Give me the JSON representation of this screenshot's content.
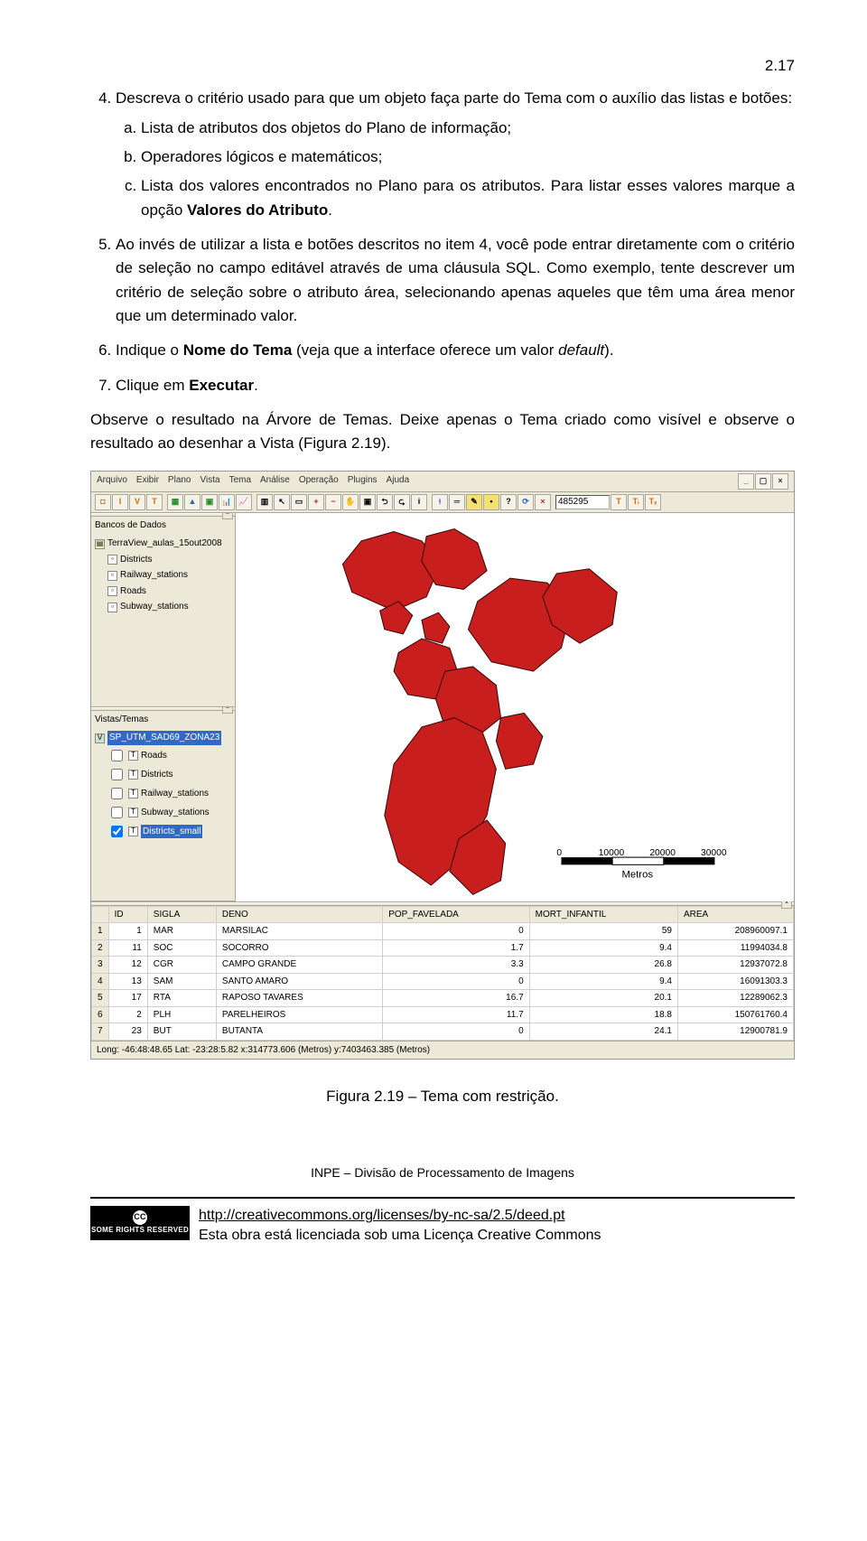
{
  "page_number": "2.17",
  "item4": {
    "lead": "Descreva o critério usado para que um objeto faça parte do Tema com o auxílio das listas e botões:",
    "a": "Lista de atributos dos objetos do Plano de informação;",
    "b": "Operadores lógicos e matemáticos;",
    "c_pre": "Lista dos valores encontrados no Plano para os atributos. Para listar esses valores marque a opção ",
    "c_bold": "Valores do Atributo",
    "c_post": "."
  },
  "item5": "Ao invés de utilizar a lista e botões descritos no item 4, você pode entrar diretamente com o critério de seleção no campo editável através de uma cláusula SQL. Como exemplo, tente descrever um critério de seleção sobre o atributo área, selecionando apenas aqueles que têm uma área menor que um determinado valor.",
  "item6": {
    "pre": "Indique o ",
    "bold": "Nome do Tema",
    "mid": " (veja que a interface oferece um valor ",
    "italic": "default",
    "post": ")."
  },
  "item7": {
    "pre": "Clique em ",
    "bold": "Executar",
    "post": "."
  },
  "observe": "Observe o resultado na Árvore de Temas. Deixe apenas o Tema criado como visível e observe o resultado ao desenhar a Vista (Figura 2.19).",
  "app": {
    "menu": [
      "Arquivo",
      "Exibir",
      "Plano",
      "Vista",
      "Tema",
      "Análise",
      "Operação",
      "Plugins",
      "Ajuda"
    ],
    "toolbar_input": "485295",
    "db_panel": {
      "title": "Bancos de Dados",
      "root": "TerraView_aulas_15out2008",
      "layers": [
        "Districts",
        "Railway_stations",
        "Roads",
        "Subway_stations"
      ]
    },
    "views_panel": {
      "title": "Vistas/Temas",
      "view": "SP_UTM_SAD69_ZONA23",
      "themes": [
        "Roads",
        "Districts",
        "Railway_stations",
        "Subway_stations",
        "Districts_small"
      ],
      "selected_index": 4
    },
    "scalebar": {
      "ticks": [
        "0",
        "10000",
        "20000",
        "30000"
      ],
      "label": "Metros"
    },
    "grid": {
      "headers": [
        "",
        "ID",
        "SIGLA",
        "DENO",
        "POP_FAVELADA",
        "MORT_INFANTIL",
        "AREA"
      ],
      "rows": [
        [
          "1",
          "1",
          "MAR",
          "MARSILAC",
          "0",
          "59",
          "208960097.1"
        ],
        [
          "2",
          "11",
          "SOC",
          "SOCORRO",
          "1.7",
          "9.4",
          "11994034.8"
        ],
        [
          "3",
          "12",
          "CGR",
          "CAMPO GRANDE",
          "3.3",
          "26.8",
          "12937072.8"
        ],
        [
          "4",
          "13",
          "SAM",
          "SANTO AMARO",
          "0",
          "9.4",
          "16091303.3"
        ],
        [
          "5",
          "17",
          "RTA",
          "RAPOSO TAVARES",
          "16.7",
          "20.1",
          "12289062.3"
        ],
        [
          "6",
          "2",
          "PLH",
          "PARELHEIROS",
          "11.7",
          "18.8",
          "150761760.4"
        ],
        [
          "7",
          "23",
          "BUT",
          "BUTANTA",
          "0",
          "24.1",
          "12900781.9"
        ]
      ]
    },
    "statusbar": "Long: -46:48:48.65 Lat: -23:28:5.82  x:314773.606 (Metros)  y:7403463.385 (Metros)"
  },
  "caption": "Figura 2.19 – Tema com restrição.",
  "footer": "INPE – Divisão de Processamento de Imagens",
  "license": {
    "badge_top": "CC",
    "badge_bottom": "SOME RIGHTS RESERVED",
    "url": "http://creativecommons.org/licenses/by-nc-sa/2.5/deed.pt",
    "text": "Esta obra está licenciada sob uma Licença Creative Commons"
  }
}
